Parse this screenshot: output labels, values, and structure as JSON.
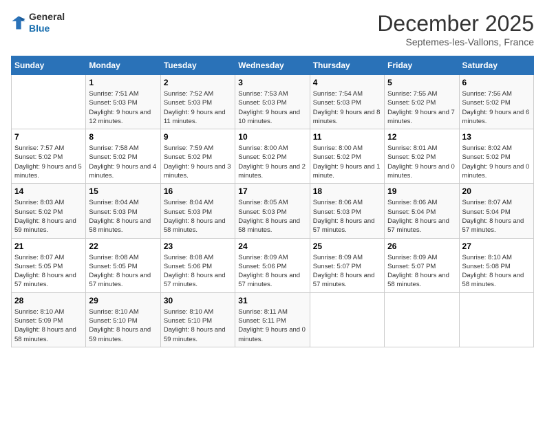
{
  "logo": {
    "line1": "General",
    "line2": "Blue"
  },
  "title": {
    "month": "December 2025",
    "location": "Septemes-les-Vallons, France"
  },
  "weekdays": [
    "Sunday",
    "Monday",
    "Tuesday",
    "Wednesday",
    "Thursday",
    "Friday",
    "Saturday"
  ],
  "weeks": [
    [
      {
        "day": "",
        "sunrise": "",
        "sunset": "",
        "daylight": ""
      },
      {
        "day": "1",
        "sunrise": "Sunrise: 7:51 AM",
        "sunset": "Sunset: 5:03 PM",
        "daylight": "Daylight: 9 hours and 12 minutes."
      },
      {
        "day": "2",
        "sunrise": "Sunrise: 7:52 AM",
        "sunset": "Sunset: 5:03 PM",
        "daylight": "Daylight: 9 hours and 11 minutes."
      },
      {
        "day": "3",
        "sunrise": "Sunrise: 7:53 AM",
        "sunset": "Sunset: 5:03 PM",
        "daylight": "Daylight: 9 hours and 10 minutes."
      },
      {
        "day": "4",
        "sunrise": "Sunrise: 7:54 AM",
        "sunset": "Sunset: 5:03 PM",
        "daylight": "Daylight: 9 hours and 8 minutes."
      },
      {
        "day": "5",
        "sunrise": "Sunrise: 7:55 AM",
        "sunset": "Sunset: 5:02 PM",
        "daylight": "Daylight: 9 hours and 7 minutes."
      },
      {
        "day": "6",
        "sunrise": "Sunrise: 7:56 AM",
        "sunset": "Sunset: 5:02 PM",
        "daylight": "Daylight: 9 hours and 6 minutes."
      }
    ],
    [
      {
        "day": "7",
        "sunrise": "Sunrise: 7:57 AM",
        "sunset": "Sunset: 5:02 PM",
        "daylight": "Daylight: 9 hours and 5 minutes."
      },
      {
        "day": "8",
        "sunrise": "Sunrise: 7:58 AM",
        "sunset": "Sunset: 5:02 PM",
        "daylight": "Daylight: 9 hours and 4 minutes."
      },
      {
        "day": "9",
        "sunrise": "Sunrise: 7:59 AM",
        "sunset": "Sunset: 5:02 PM",
        "daylight": "Daylight: 9 hours and 3 minutes."
      },
      {
        "day": "10",
        "sunrise": "Sunrise: 8:00 AM",
        "sunset": "Sunset: 5:02 PM",
        "daylight": "Daylight: 9 hours and 2 minutes."
      },
      {
        "day": "11",
        "sunrise": "Sunrise: 8:00 AM",
        "sunset": "Sunset: 5:02 PM",
        "daylight": "Daylight: 9 hours and 1 minute."
      },
      {
        "day": "12",
        "sunrise": "Sunrise: 8:01 AM",
        "sunset": "Sunset: 5:02 PM",
        "daylight": "Daylight: 9 hours and 0 minutes."
      },
      {
        "day": "13",
        "sunrise": "Sunrise: 8:02 AM",
        "sunset": "Sunset: 5:02 PM",
        "daylight": "Daylight: 9 hours and 0 minutes."
      }
    ],
    [
      {
        "day": "14",
        "sunrise": "Sunrise: 8:03 AM",
        "sunset": "Sunset: 5:02 PM",
        "daylight": "Daylight: 8 hours and 59 minutes."
      },
      {
        "day": "15",
        "sunrise": "Sunrise: 8:04 AM",
        "sunset": "Sunset: 5:03 PM",
        "daylight": "Daylight: 8 hours and 58 minutes."
      },
      {
        "day": "16",
        "sunrise": "Sunrise: 8:04 AM",
        "sunset": "Sunset: 5:03 PM",
        "daylight": "Daylight: 8 hours and 58 minutes."
      },
      {
        "day": "17",
        "sunrise": "Sunrise: 8:05 AM",
        "sunset": "Sunset: 5:03 PM",
        "daylight": "Daylight: 8 hours and 58 minutes."
      },
      {
        "day": "18",
        "sunrise": "Sunrise: 8:06 AM",
        "sunset": "Sunset: 5:03 PM",
        "daylight": "Daylight: 8 hours and 57 minutes."
      },
      {
        "day": "19",
        "sunrise": "Sunrise: 8:06 AM",
        "sunset": "Sunset: 5:04 PM",
        "daylight": "Daylight: 8 hours and 57 minutes."
      },
      {
        "day": "20",
        "sunrise": "Sunrise: 8:07 AM",
        "sunset": "Sunset: 5:04 PM",
        "daylight": "Daylight: 8 hours and 57 minutes."
      }
    ],
    [
      {
        "day": "21",
        "sunrise": "Sunrise: 8:07 AM",
        "sunset": "Sunset: 5:05 PM",
        "daylight": "Daylight: 8 hours and 57 minutes."
      },
      {
        "day": "22",
        "sunrise": "Sunrise: 8:08 AM",
        "sunset": "Sunset: 5:05 PM",
        "daylight": "Daylight: 8 hours and 57 minutes."
      },
      {
        "day": "23",
        "sunrise": "Sunrise: 8:08 AM",
        "sunset": "Sunset: 5:06 PM",
        "daylight": "Daylight: 8 hours and 57 minutes."
      },
      {
        "day": "24",
        "sunrise": "Sunrise: 8:09 AM",
        "sunset": "Sunset: 5:06 PM",
        "daylight": "Daylight: 8 hours and 57 minutes."
      },
      {
        "day": "25",
        "sunrise": "Sunrise: 8:09 AM",
        "sunset": "Sunset: 5:07 PM",
        "daylight": "Daylight: 8 hours and 57 minutes."
      },
      {
        "day": "26",
        "sunrise": "Sunrise: 8:09 AM",
        "sunset": "Sunset: 5:07 PM",
        "daylight": "Daylight: 8 hours and 58 minutes."
      },
      {
        "day": "27",
        "sunrise": "Sunrise: 8:10 AM",
        "sunset": "Sunset: 5:08 PM",
        "daylight": "Daylight: 8 hours and 58 minutes."
      }
    ],
    [
      {
        "day": "28",
        "sunrise": "Sunrise: 8:10 AM",
        "sunset": "Sunset: 5:09 PM",
        "daylight": "Daylight: 8 hours and 58 minutes."
      },
      {
        "day": "29",
        "sunrise": "Sunrise: 8:10 AM",
        "sunset": "Sunset: 5:10 PM",
        "daylight": "Daylight: 8 hours and 59 minutes."
      },
      {
        "day": "30",
        "sunrise": "Sunrise: 8:10 AM",
        "sunset": "Sunset: 5:10 PM",
        "daylight": "Daylight: 8 hours and 59 minutes."
      },
      {
        "day": "31",
        "sunrise": "Sunrise: 8:11 AM",
        "sunset": "Sunset: 5:11 PM",
        "daylight": "Daylight: 9 hours and 0 minutes."
      },
      {
        "day": "",
        "sunrise": "",
        "sunset": "",
        "daylight": ""
      },
      {
        "day": "",
        "sunrise": "",
        "sunset": "",
        "daylight": ""
      },
      {
        "day": "",
        "sunrise": "",
        "sunset": "",
        "daylight": ""
      }
    ]
  ]
}
